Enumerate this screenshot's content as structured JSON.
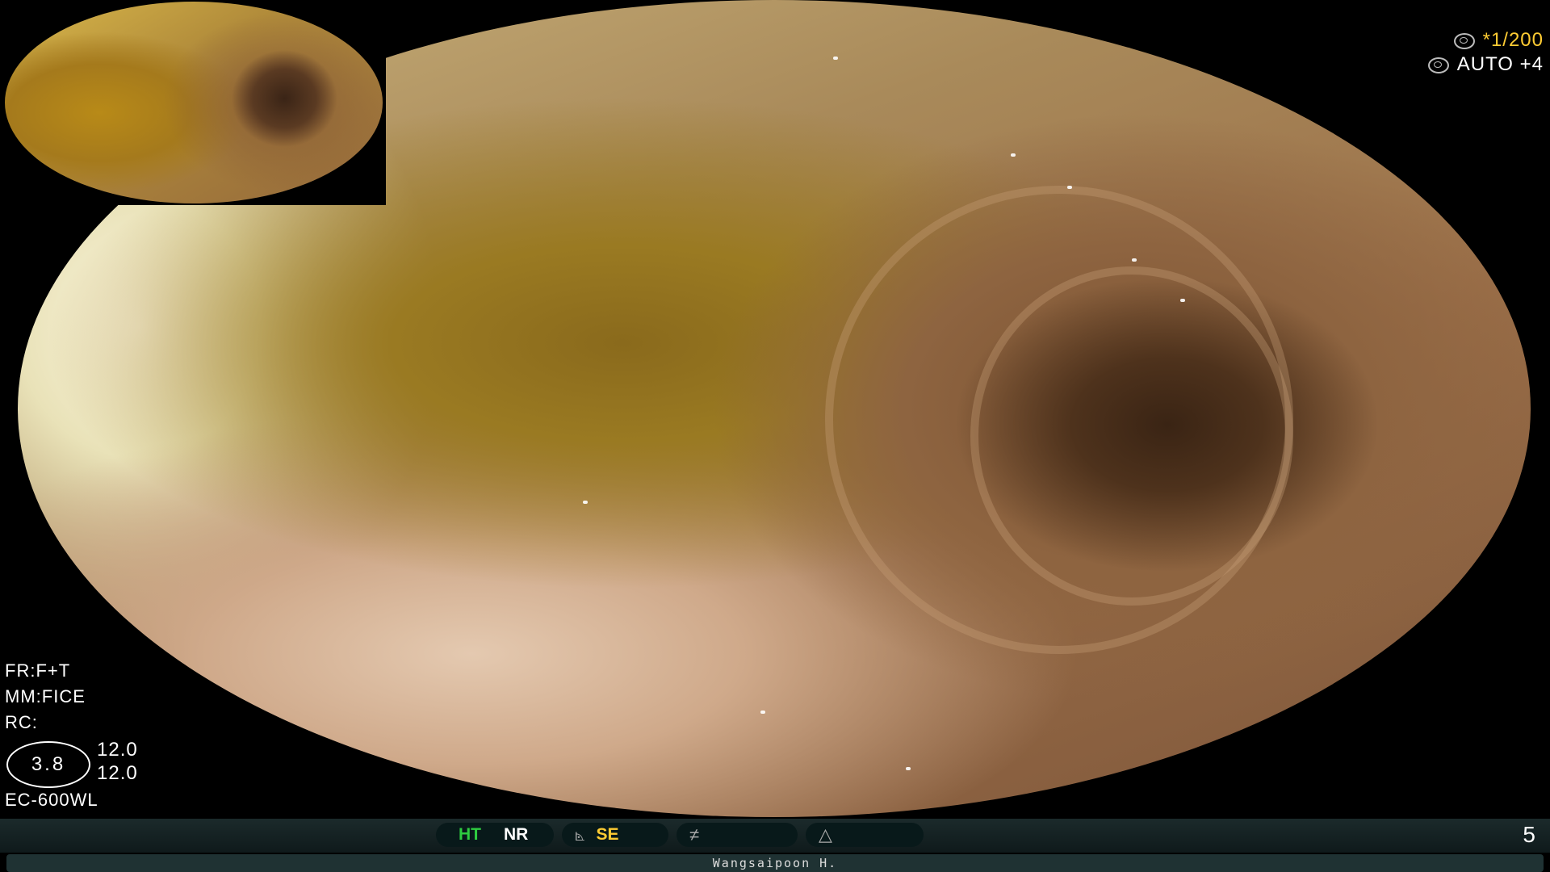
{
  "overlay": {
    "shutter": {
      "icon": "shutter-icon",
      "prefix": "*",
      "value": "1/200"
    },
    "exposure": {
      "icon": "iris-icon",
      "value": "AUTO +4"
    },
    "left_info": {
      "fr": "FR:F+T",
      "mm": "MM:FICE",
      "rc": "RC:",
      "zoom": "3.8",
      "value_1": "12.0",
      "value_2": "12.0",
      "scope_model": "EC-600WL"
    }
  },
  "status_bar": {
    "modes": [
      {
        "label": "HT",
        "color": "#2ecc40"
      },
      {
        "label": "NR",
        "color": "#ffffff"
      },
      {
        "label": "SE",
        "color": "#ffcc33"
      }
    ],
    "glyphs": [
      "structure-enhance-glyph",
      "color-enhance-glyph",
      "auto-contrast-glyph"
    ],
    "page_number": "5"
  },
  "operator": "Wangsaipoon H."
}
